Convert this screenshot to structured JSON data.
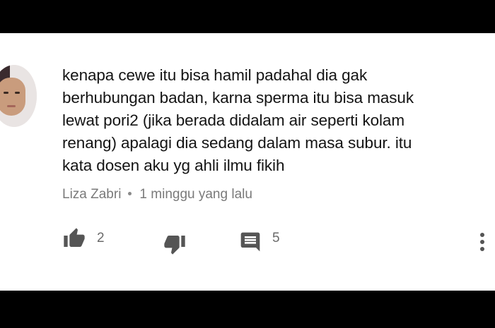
{
  "comment": {
    "text": "kenapa cewe itu bisa hamil padahal dia gak\nberhubungan badan, karna sperma itu bisa masuk\nlewat pori2 (jika berada didalam air seperti kolam\nrenang) apalagi dia sedang dalam masa subur. itu\nkata dosen aku yg ahli ilmu fikih",
    "author": "Liza Zabri",
    "time_ago": "1 minggu yang lalu"
  },
  "actions": {
    "like_icon": "thumb-up-icon",
    "like_count": "2",
    "dislike_icon": "thumb-down-icon",
    "reply_icon": "comment-icon",
    "reply_count": "5",
    "more_icon": "more-vertical-icon"
  },
  "colors": {
    "text": "#141414",
    "meta": "#7a7a7a",
    "icon": "#555555",
    "background": "#ffffff",
    "letterbox": "#000000"
  }
}
